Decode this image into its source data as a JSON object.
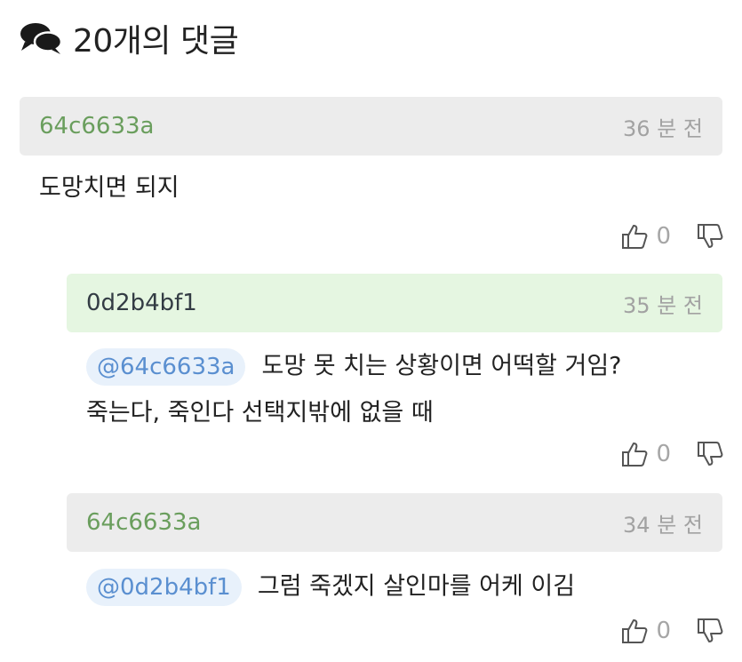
{
  "header": {
    "icon": "speech-bubbles-icon",
    "title": "20개의 댓글"
  },
  "comments": [
    {
      "author": "64c6633a",
      "time": "36 분 전",
      "body": "도망치면 되지",
      "likes": "0"
    },
    {
      "author": "0d2b4bf1",
      "time": "35 분 전",
      "mention": "@64c6633a",
      "body_line1": "도망 못 치는 상황이면 어떡할 거임?",
      "body_line2": "죽는다, 죽인다 선택지밖에 없을 때",
      "likes": "0"
    },
    {
      "author": "64c6633a",
      "time": "34 분 전",
      "mention": "@0d2b4bf1",
      "body": "그럼 죽겠지 살인마를 어케 이김",
      "likes": "0"
    }
  ],
  "icons": {
    "like": "thumbs-up-icon",
    "dislike": "thumbs-down-icon"
  },
  "colors": {
    "author_green": "#6a9e5d",
    "mention_blue": "#5a8fd0",
    "header_gray": "#ececec",
    "header_green": "#e5f6e1"
  }
}
